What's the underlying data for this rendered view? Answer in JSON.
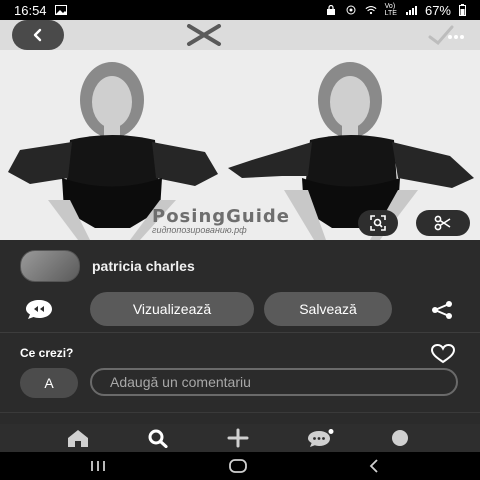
{
  "status_bar": {
    "time": "16:54",
    "battery": "67%",
    "network_top": "Vo)",
    "network_bottom": "LTE"
  },
  "pin_header": {
    "back_icon": "chevron-left-icon",
    "app_logo_icon": "x-mark-icon",
    "more_icon": "more-dots-icon"
  },
  "image": {
    "watermark_title": "PosingGuide",
    "watermark_subtitle": "гидпопозированию.рф",
    "visual_search_icon": "visual-search-icon",
    "crop_icon": "scissors-icon"
  },
  "author": {
    "name": "patricia charles"
  },
  "actions": {
    "visit_label": "Vizualizează",
    "save_label": "Salvează",
    "comment_icon": "chat-bubble-icon",
    "share_icon": "share-icon"
  },
  "comments": {
    "heading": "Ce crezi?",
    "avatar_initial": "A",
    "input_placeholder": "Adaugă un comentariu",
    "like_icon": "heart-icon"
  },
  "tab_bar": {
    "items": [
      "home-icon",
      "search-icon",
      "create-plus-icon",
      "messages-icon",
      "profile-icon"
    ]
  },
  "system_nav": {
    "items": [
      "recents-icon",
      "home-circle-icon",
      "back-arrow-icon"
    ]
  }
}
